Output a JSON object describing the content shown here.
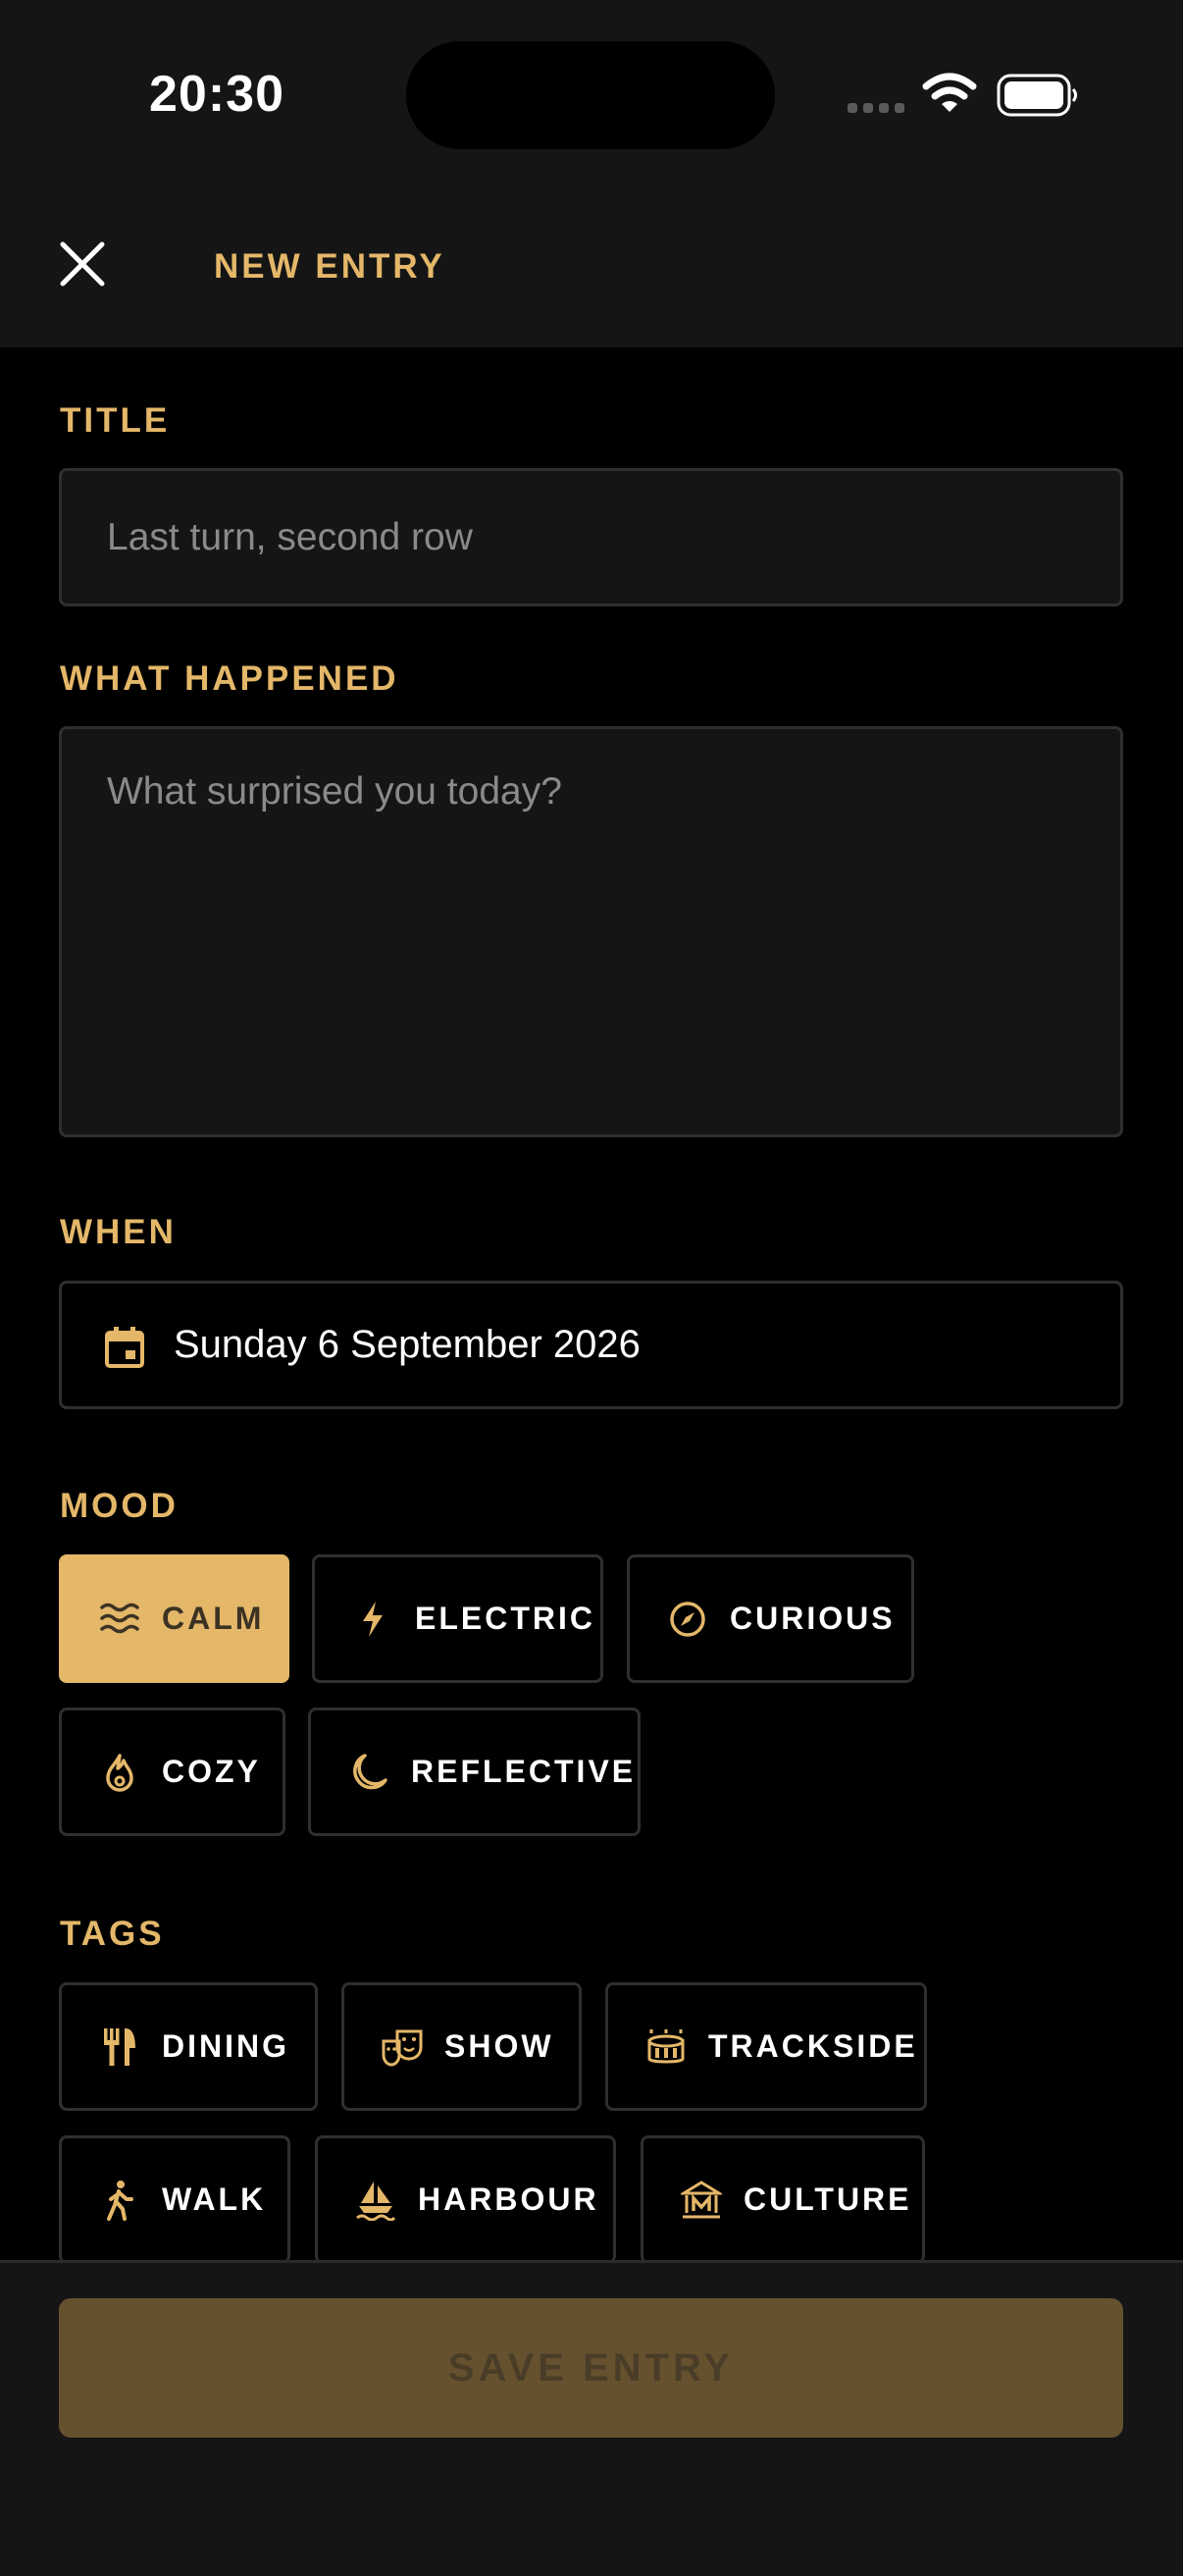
{
  "status_bar": {
    "time": "20:30"
  },
  "header": {
    "title": "NEW ENTRY",
    "close_icon": "close-icon"
  },
  "form": {
    "title_label": "TITLE",
    "title_placeholder": "Last turn, second row",
    "body_label": "WHAT HAPPENED",
    "body_placeholder": "What surprised you today?",
    "when_label": "WHEN",
    "date_value": "Sunday 6 September 2026",
    "mood_label": "MOOD",
    "moods": [
      {
        "label": "CALM",
        "icon": "waves-icon",
        "selected": true
      },
      {
        "label": "ELECTRIC",
        "icon": "lightning-icon",
        "selected": false
      },
      {
        "label": "CURIOUS",
        "icon": "compass-icon",
        "selected": false
      },
      {
        "label": "COZY",
        "icon": "flame-icon",
        "selected": false
      },
      {
        "label": "REFLECTIVE",
        "icon": "moon-icon",
        "selected": false
      }
    ],
    "tags_label": "TAGS",
    "tags": [
      {
        "label": "DINING",
        "icon": "fork-knife-icon"
      },
      {
        "label": "SHOW",
        "icon": "theater-masks-icon"
      },
      {
        "label": "TRACKSIDE",
        "icon": "stadium-icon"
      },
      {
        "label": "WALK",
        "icon": "walking-icon"
      },
      {
        "label": "HARBOUR",
        "icon": "sailboat-icon"
      },
      {
        "label": "CULTURE",
        "icon": "museum-icon"
      }
    ]
  },
  "footer": {
    "save_label": "SAVE ENTRY"
  },
  "colors": {
    "accent": "#e4b769",
    "background": "#000000",
    "surface": "#151515",
    "border": "#2f2f2f",
    "save_disabled_bg": "#66512f",
    "save_disabled_text": "#4a3d28"
  }
}
